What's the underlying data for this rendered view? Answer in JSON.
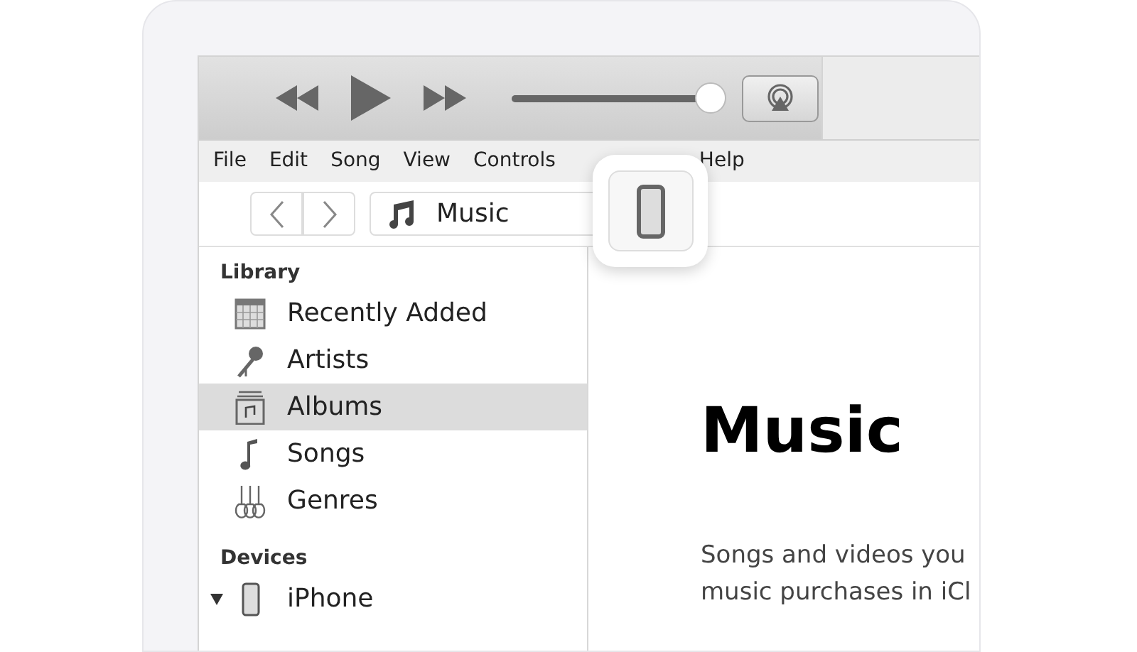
{
  "player": {
    "volume": {
      "level": 1.0
    }
  },
  "menu": [
    "File",
    "Edit",
    "Song",
    "View",
    "Controls",
    "Help"
  ],
  "nav": {
    "source": "Music"
  },
  "sidebar": {
    "sections": [
      {
        "title": "Library",
        "items": [
          {
            "label": "Recently Added",
            "kind": "calendar",
            "selected": false
          },
          {
            "label": "Artists",
            "kind": "mic",
            "selected": false
          },
          {
            "label": "Albums",
            "kind": "album",
            "selected": true
          },
          {
            "label": "Songs",
            "kind": "note",
            "selected": false
          },
          {
            "label": "Genres",
            "kind": "guitars",
            "selected": false
          }
        ]
      },
      {
        "title": "Devices",
        "items": [
          {
            "label": "iPhone",
            "kind": "phone",
            "selected": false,
            "expanded": true
          }
        ]
      }
    ]
  },
  "content": {
    "title": "Music",
    "lines": [
      "Songs and videos you",
      "music purchases in iCl"
    ]
  }
}
